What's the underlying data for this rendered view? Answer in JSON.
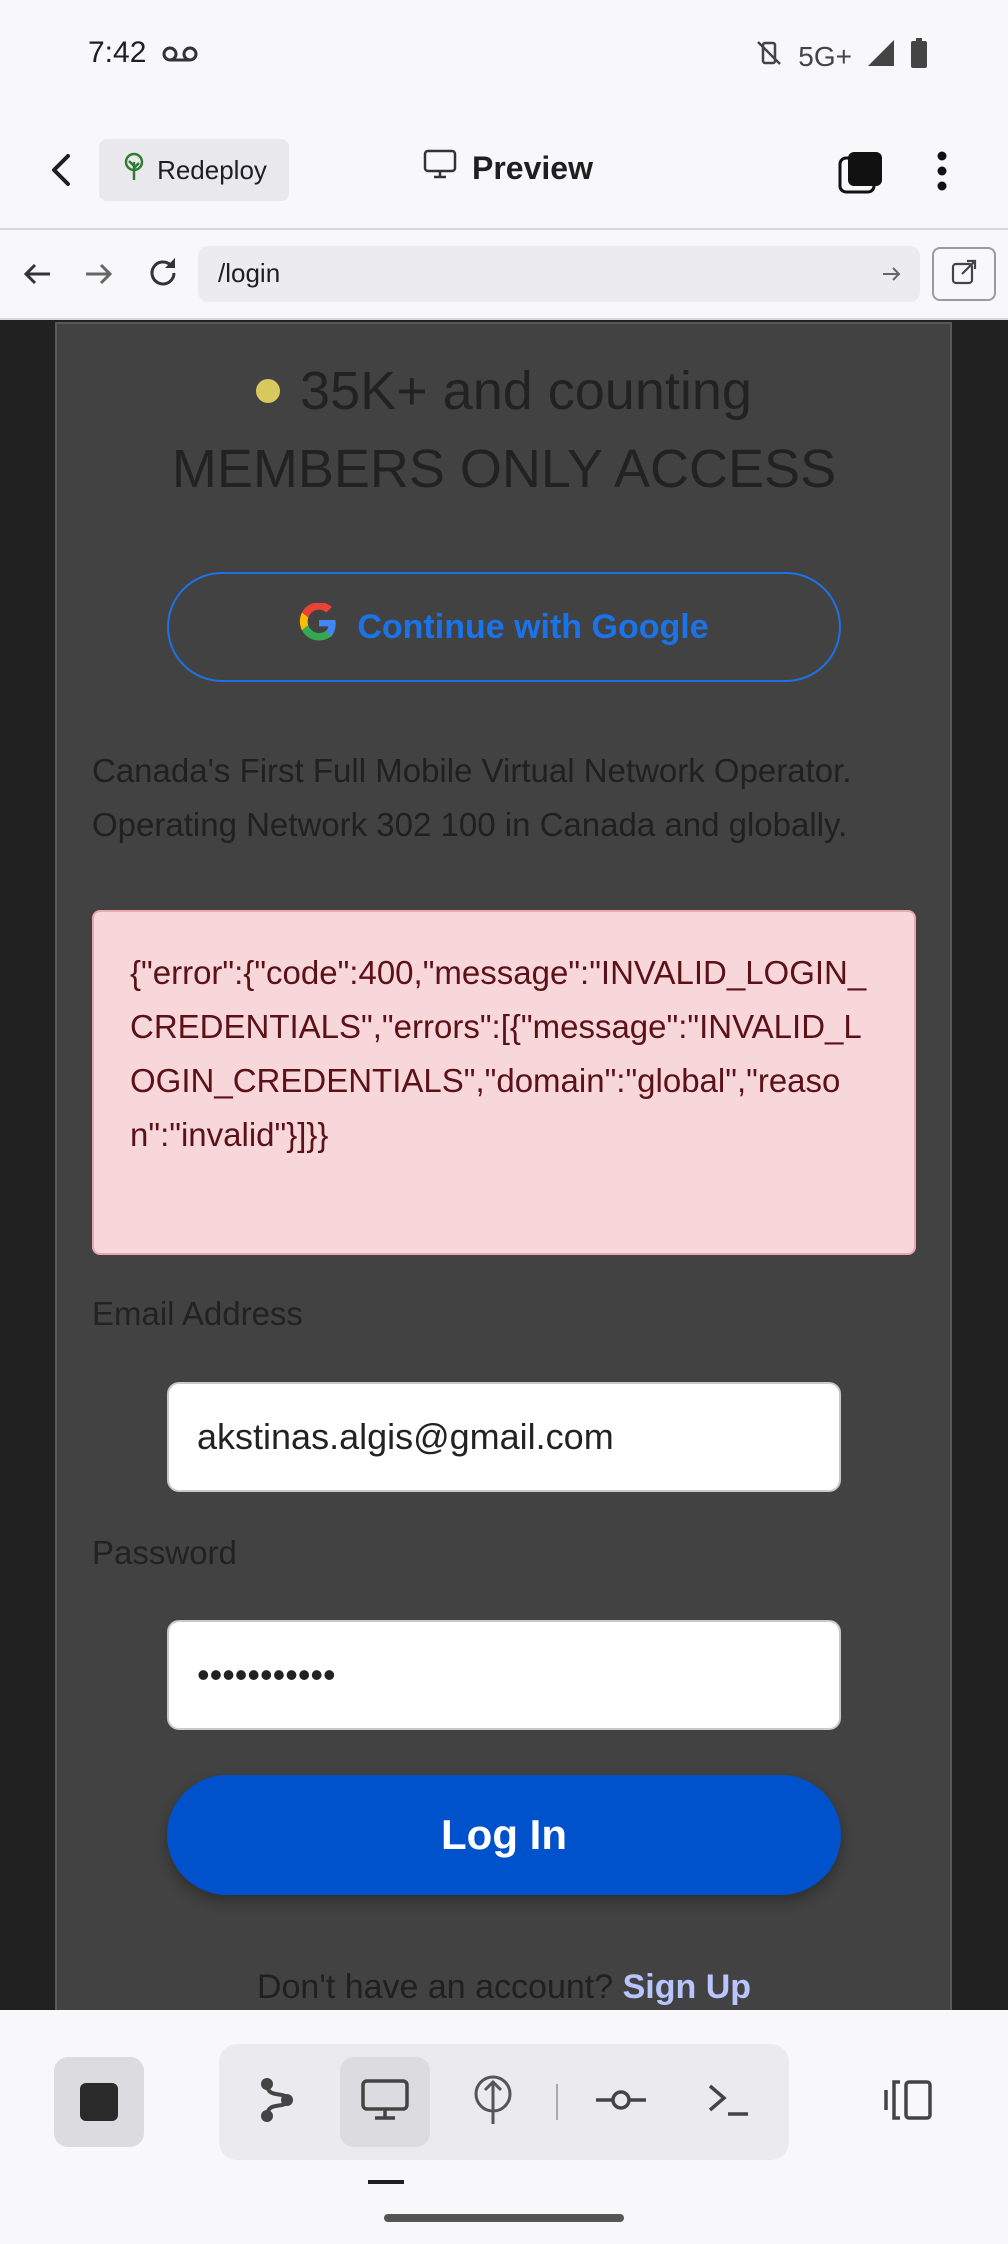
{
  "status_bar": {
    "time": "7:42",
    "network": "5G+",
    "icons": [
      "voicemail-icon",
      "mute-vibrate-icon",
      "signal-icon",
      "battery-icon"
    ]
  },
  "app_bar": {
    "redeploy_label": "Redeploy",
    "preview_label": "Preview"
  },
  "url_bar": {
    "url": "/login"
  },
  "page": {
    "headline_line1": "35K+ and counting",
    "headline_line2": "MEMBERS ONLY ACCESS",
    "google_button": "Continue with Google",
    "tagline": "Canada's First Full Mobile Virtual Network Operator. Operating Network 302 100 in Canada and globally.",
    "error_message": "{\"error\":{\"code\":400,\"message\":\"INVALID_LOGIN_CREDENTIALS\",\"errors\":[{\"message\":\"INVALID_LOGIN_CREDENTIALS\",\"domain\":\"global\",\"reason\":\"invalid\"}]}}",
    "email_label": "Email Address",
    "email_value": "akstinas.algis@gmail.com",
    "password_label": "Password",
    "password_value": "•••••••••••",
    "login_button": "Log In",
    "signup_prompt": "Don't have an account?",
    "signup_link": "Sign Up"
  },
  "colors": {
    "accent_blue": "#0052cc",
    "google_blue": "#1a73e8",
    "error_bg": "#f8d7da",
    "card_bg": "#424242",
    "status_dot": "#d7c95c"
  }
}
